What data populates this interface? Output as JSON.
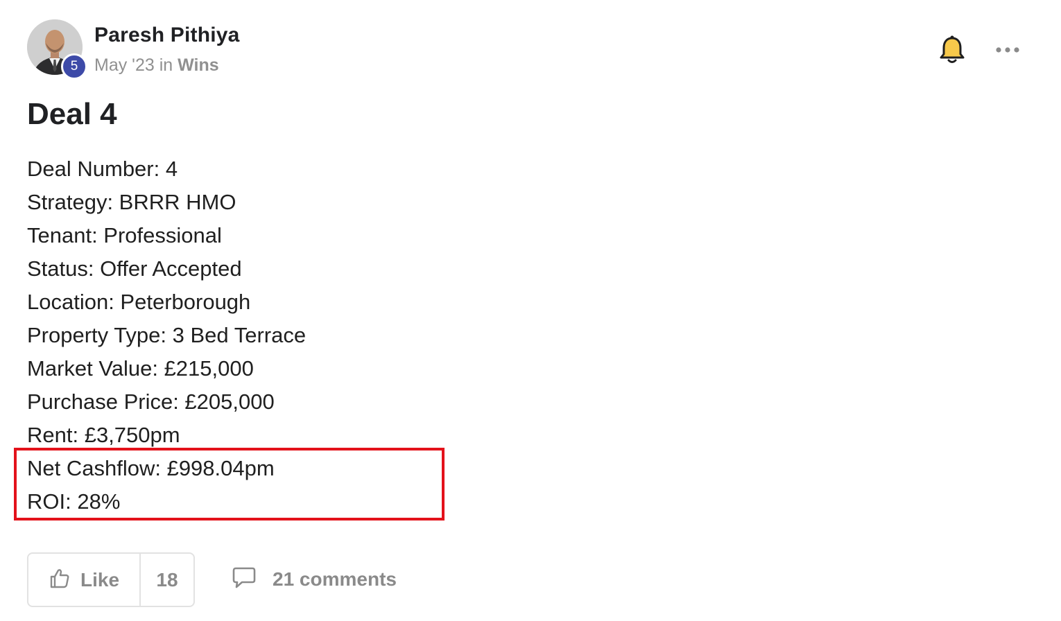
{
  "post": {
    "author": {
      "name": "Paresh Pithiya",
      "level": "5",
      "date": "May '23",
      "in_word": "in",
      "category": "Wins"
    },
    "title": "Deal 4",
    "lines": [
      "Deal Number: 4",
      "Strategy: BRRR HMO",
      "Tenant: Professional",
      "Status: Offer Accepted",
      "Location: Peterborough",
      "Property Type: 3 Bed Terrace",
      "Market Value: £215,000",
      "Purchase Price: £205,000",
      "Rent: £3,750pm",
      "Net Cashflow: £998.04pm",
      "ROI: 28%"
    ],
    "actions": {
      "like_label": "Like",
      "like_count": "18",
      "comments_label": "21 comments"
    },
    "icons": {
      "bell": "bell-icon",
      "more": "more-horizontal-icon",
      "like": "thumbs-up-icon",
      "comment": "comment-bubble-icon"
    },
    "colors": {
      "badge": "#3d4aa8",
      "bell_fill": "#f7c94b",
      "highlight_border": "#e3121b",
      "muted_text": "#8a8a8a"
    }
  }
}
